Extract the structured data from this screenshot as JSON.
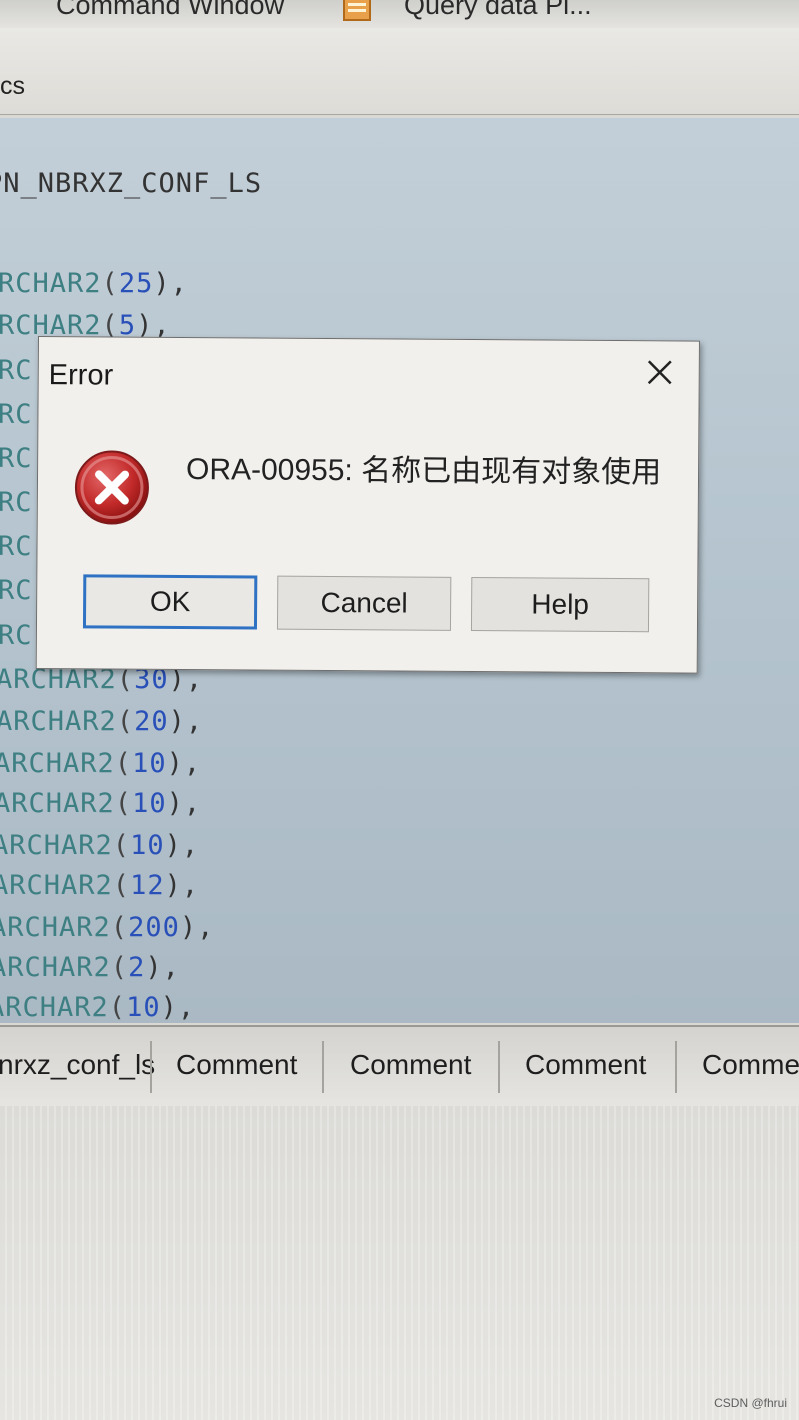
{
  "window_tabs": [
    {
      "label": "Command Window"
    },
    {
      "label": "Query data Pl..."
    }
  ],
  "sub_tab_partial": "cs",
  "editor": {
    "table_name_partial": "PN_NBRXZ_CONF_LS",
    "lines": [
      {
        "type": "RCHAR2",
        "size": "25",
        "end": "),"
      },
      {
        "type": "RCHAR2",
        "size": "5",
        "end": "),"
      },
      {
        "type": "RC",
        "size": "",
        "end": ""
      },
      {
        "type": "RC",
        "size": "",
        "end": ""
      },
      {
        "type": "RC",
        "size": "",
        "end": ""
      },
      {
        "type": "RC",
        "size": "",
        "end": ""
      },
      {
        "type": "RC",
        "size": "",
        "end": ""
      },
      {
        "type": "RC",
        "size": "",
        "end": ""
      },
      {
        "type": "RC",
        "size": "",
        "end": ""
      },
      {
        "type": "ARCHAR2",
        "size": "30",
        "end": "),"
      },
      {
        "type": "ARCHAR2",
        "size": "20",
        "end": "),"
      },
      {
        "type": "ARCHAR2",
        "size": "10",
        "end": "),"
      },
      {
        "type": "ARCHAR2",
        "size": "10",
        "end": "),"
      },
      {
        "type": "ARCHAR2",
        "size": "10",
        "end": "),"
      },
      {
        "type": "ARCHAR2",
        "size": "12",
        "end": "),"
      },
      {
        "type": "ARCHAR2",
        "size": "200",
        "end": "),"
      },
      {
        "type": "ARCHAR2",
        "size": "2",
        "end": "),"
      },
      {
        "type": "ARCHAR2",
        "size": "10",
        "end": "),"
      }
    ]
  },
  "dialog": {
    "title": "Error",
    "message": "ORA-00955: 名称已由现有对象使用",
    "icon": "error-x-icon",
    "buttons": {
      "ok": "OK",
      "cancel": "Cancel",
      "help": "Help"
    }
  },
  "result_tabs": [
    {
      "label": "nrxz_conf_ls"
    },
    {
      "label": "Comment"
    },
    {
      "label": "Comment"
    },
    {
      "label": "Comment"
    },
    {
      "label": "Comme"
    }
  ],
  "watermark": "CSDN @fhrui",
  "colors": {
    "keyword": "#3d7f82",
    "number": "#2950b8",
    "ok_border": "#2f72c4",
    "error_red": "#b71c1c"
  }
}
